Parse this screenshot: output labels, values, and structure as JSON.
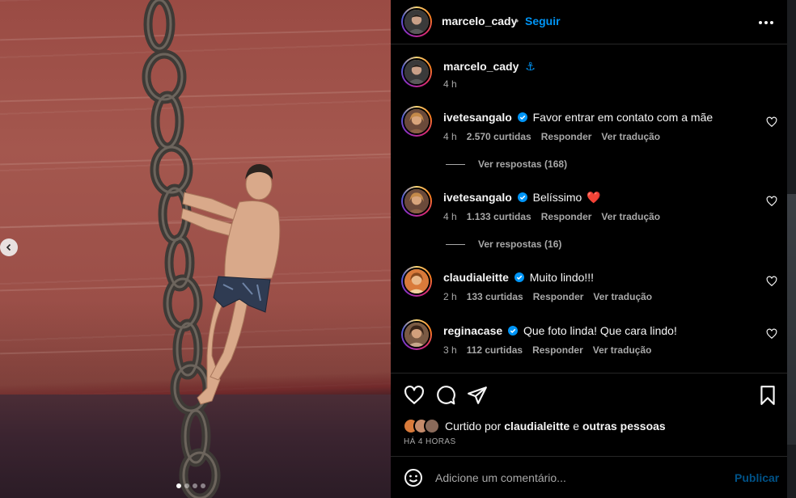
{
  "post": {
    "author": "marcelo_cady",
    "follow_label": "Seguir",
    "separator": "•",
    "caption": {
      "username": "marcelo_cady",
      "text": "⚓",
      "time": "4 h"
    }
  },
  "photo": {
    "carousel_dots": 4,
    "active_dot": 0
  },
  "comments": [
    {
      "username": "ivetesangalo",
      "verified": true,
      "text": "Favor entrar em contato com a mãe",
      "time": "4 h",
      "likes": "2.570 curtidas",
      "reply_label": "Responder",
      "translate_label": "Ver tradução",
      "view_replies": "Ver respostas (168)",
      "avatar_color": "#c99a6b"
    },
    {
      "username": "ivetesangalo",
      "verified": true,
      "text": "Belíssimo",
      "emoji": "❤️",
      "time": "4 h",
      "likes": "1.133 curtidas",
      "reply_label": "Responder",
      "translate_label": "Ver tradução",
      "view_replies": "Ver respostas (16)",
      "avatar_color": "#c99a6b"
    },
    {
      "username": "claudialeitte",
      "verified": true,
      "text": "Muito lindo!!!",
      "time": "2 h",
      "likes": "133 curtidas",
      "reply_label": "Responder",
      "translate_label": "Ver tradução",
      "avatar_color": "#e2b07a"
    },
    {
      "username": "reginacase",
      "verified": true,
      "text": "Que foto linda! Que cara lindo!",
      "time": "3 h",
      "likes": "112 curtidas",
      "reply_label": "Responder",
      "translate_label": "Ver tradução",
      "avatar_color": "#b07d57"
    }
  ],
  "likes": {
    "prefix": "Curtido por",
    "user": "claudialeitte",
    "conj": "e",
    "others": "outras pessoas",
    "time_ago": "HÁ 4 HORAS"
  },
  "composer": {
    "placeholder": "Adicione um comentário...",
    "publish_label": "Publicar"
  },
  "colors": {
    "accent": "#0095f6",
    "verified": "#0095f6",
    "muted": "#a8a8a8",
    "heart": "#ed4956"
  },
  "icons": [
    "chevron-left-icon",
    "more-icon",
    "anchor-icon",
    "verified-icon",
    "heart-icon",
    "comment-icon",
    "share-icon",
    "bookmark-icon",
    "emoji-icon"
  ]
}
